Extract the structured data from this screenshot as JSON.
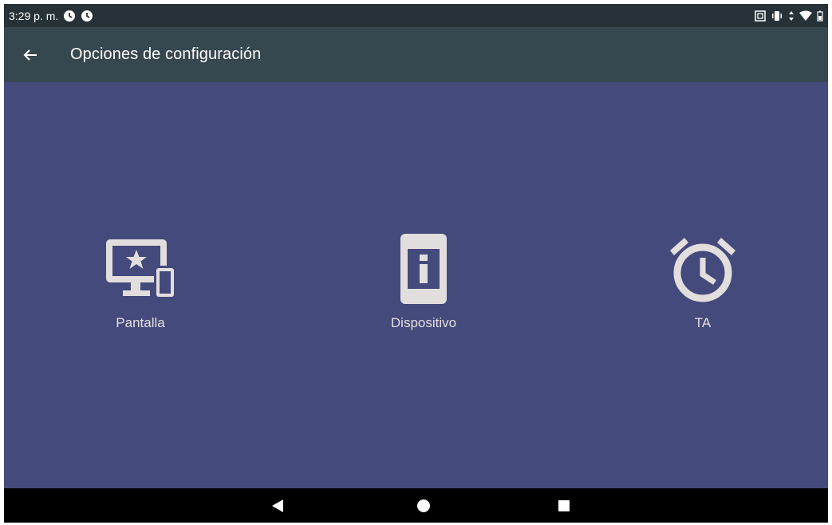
{
  "status_bar": {
    "time": "3:29 p. m.",
    "left_icons": [
      "alarm-clock-icon",
      "alarm-clock-icon"
    ],
    "right_icons": [
      "screenshot-icon",
      "vibrate-icon",
      "data-transfer-icon",
      "wifi-icon",
      "battery-icon"
    ]
  },
  "app_bar": {
    "back_icon": "arrow-back-icon",
    "title": "Opciones de configuración"
  },
  "options": [
    {
      "label": "Pantalla",
      "icon": "devices-star-icon"
    },
    {
      "label": "Dispositivo",
      "icon": "device-info-icon"
    },
    {
      "label": "TA",
      "icon": "alarm-clock-icon"
    }
  ],
  "nav_bar": {
    "buttons": [
      "back-triangle-icon",
      "home-circle-icon",
      "recents-square-icon"
    ]
  },
  "colors": {
    "status_bar": "#263238",
    "app_bar": "#37474f",
    "background": "#454a7c",
    "icon_color": "#e3dede",
    "nav_bar": "#000000"
  }
}
